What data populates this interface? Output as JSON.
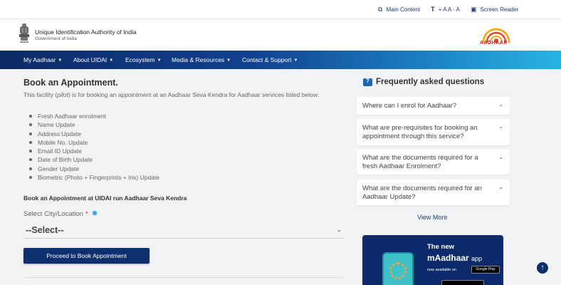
{
  "utility_bar": {
    "main_content": "Main Content",
    "text_size": "+ A A - A",
    "screen_reader": "Screen Reader"
  },
  "header": {
    "org_name": "Unique Identification Authority of India",
    "gov_name": "Government of India",
    "logo_text": "AADHAAR"
  },
  "nav": {
    "items": [
      {
        "label": "My Aadhaar"
      },
      {
        "label": "About UIDAI"
      },
      {
        "label": "Ecosystem"
      },
      {
        "label": "Media & Resources"
      },
      {
        "label": "Contact & Support"
      }
    ]
  },
  "main": {
    "title": "Book an Appointment.",
    "intro_before": "This facility (",
    "intro_pilot": "pilot",
    "intro_after": ") is for booking an appointment at an Aadhaar Seva Kendra for Aadhaar services listed below:",
    "services": [
      "Fresh Aadhaar enrolment",
      "Name Update",
      "Address Update",
      "Mobile No. Update",
      "Email ID Update",
      "Date of Birth Update",
      "Gender Update",
      "Biometric (Photo + Fingerprints + Iris) Update"
    ],
    "subheading": "Book an Appointment at UIDAI run Aadhaar Seva Kendra",
    "city_label": "Select City/Location",
    "required_mark": "*",
    "select_value": "--Select--",
    "proceed_button": "Proceed to Book Appointment"
  },
  "faq": {
    "title": "Frequently asked questions",
    "items": [
      {
        "question": "Where can I enrol for Aadhaar?"
      },
      {
        "question": "What are pre-requisites for booking an appointment through this service?"
      },
      {
        "question": "What are the documents required for a fresh Aadhaar Enrolment?"
      },
      {
        "question": "What are the documents required for an Aadhaar Update?"
      }
    ],
    "view_more": "View More"
  },
  "banner": {
    "line1": "The new",
    "app_name": "mAadhaar",
    "app_suffix": "app",
    "available": "now available on",
    "store": "Google Play"
  },
  "colors": {
    "nav_start": "#0b2a66",
    "nav_end": "#28b4e3",
    "primary_button": "#0d2f6e",
    "required": "#d2232a",
    "accent_blue": "#1c64b4"
  }
}
